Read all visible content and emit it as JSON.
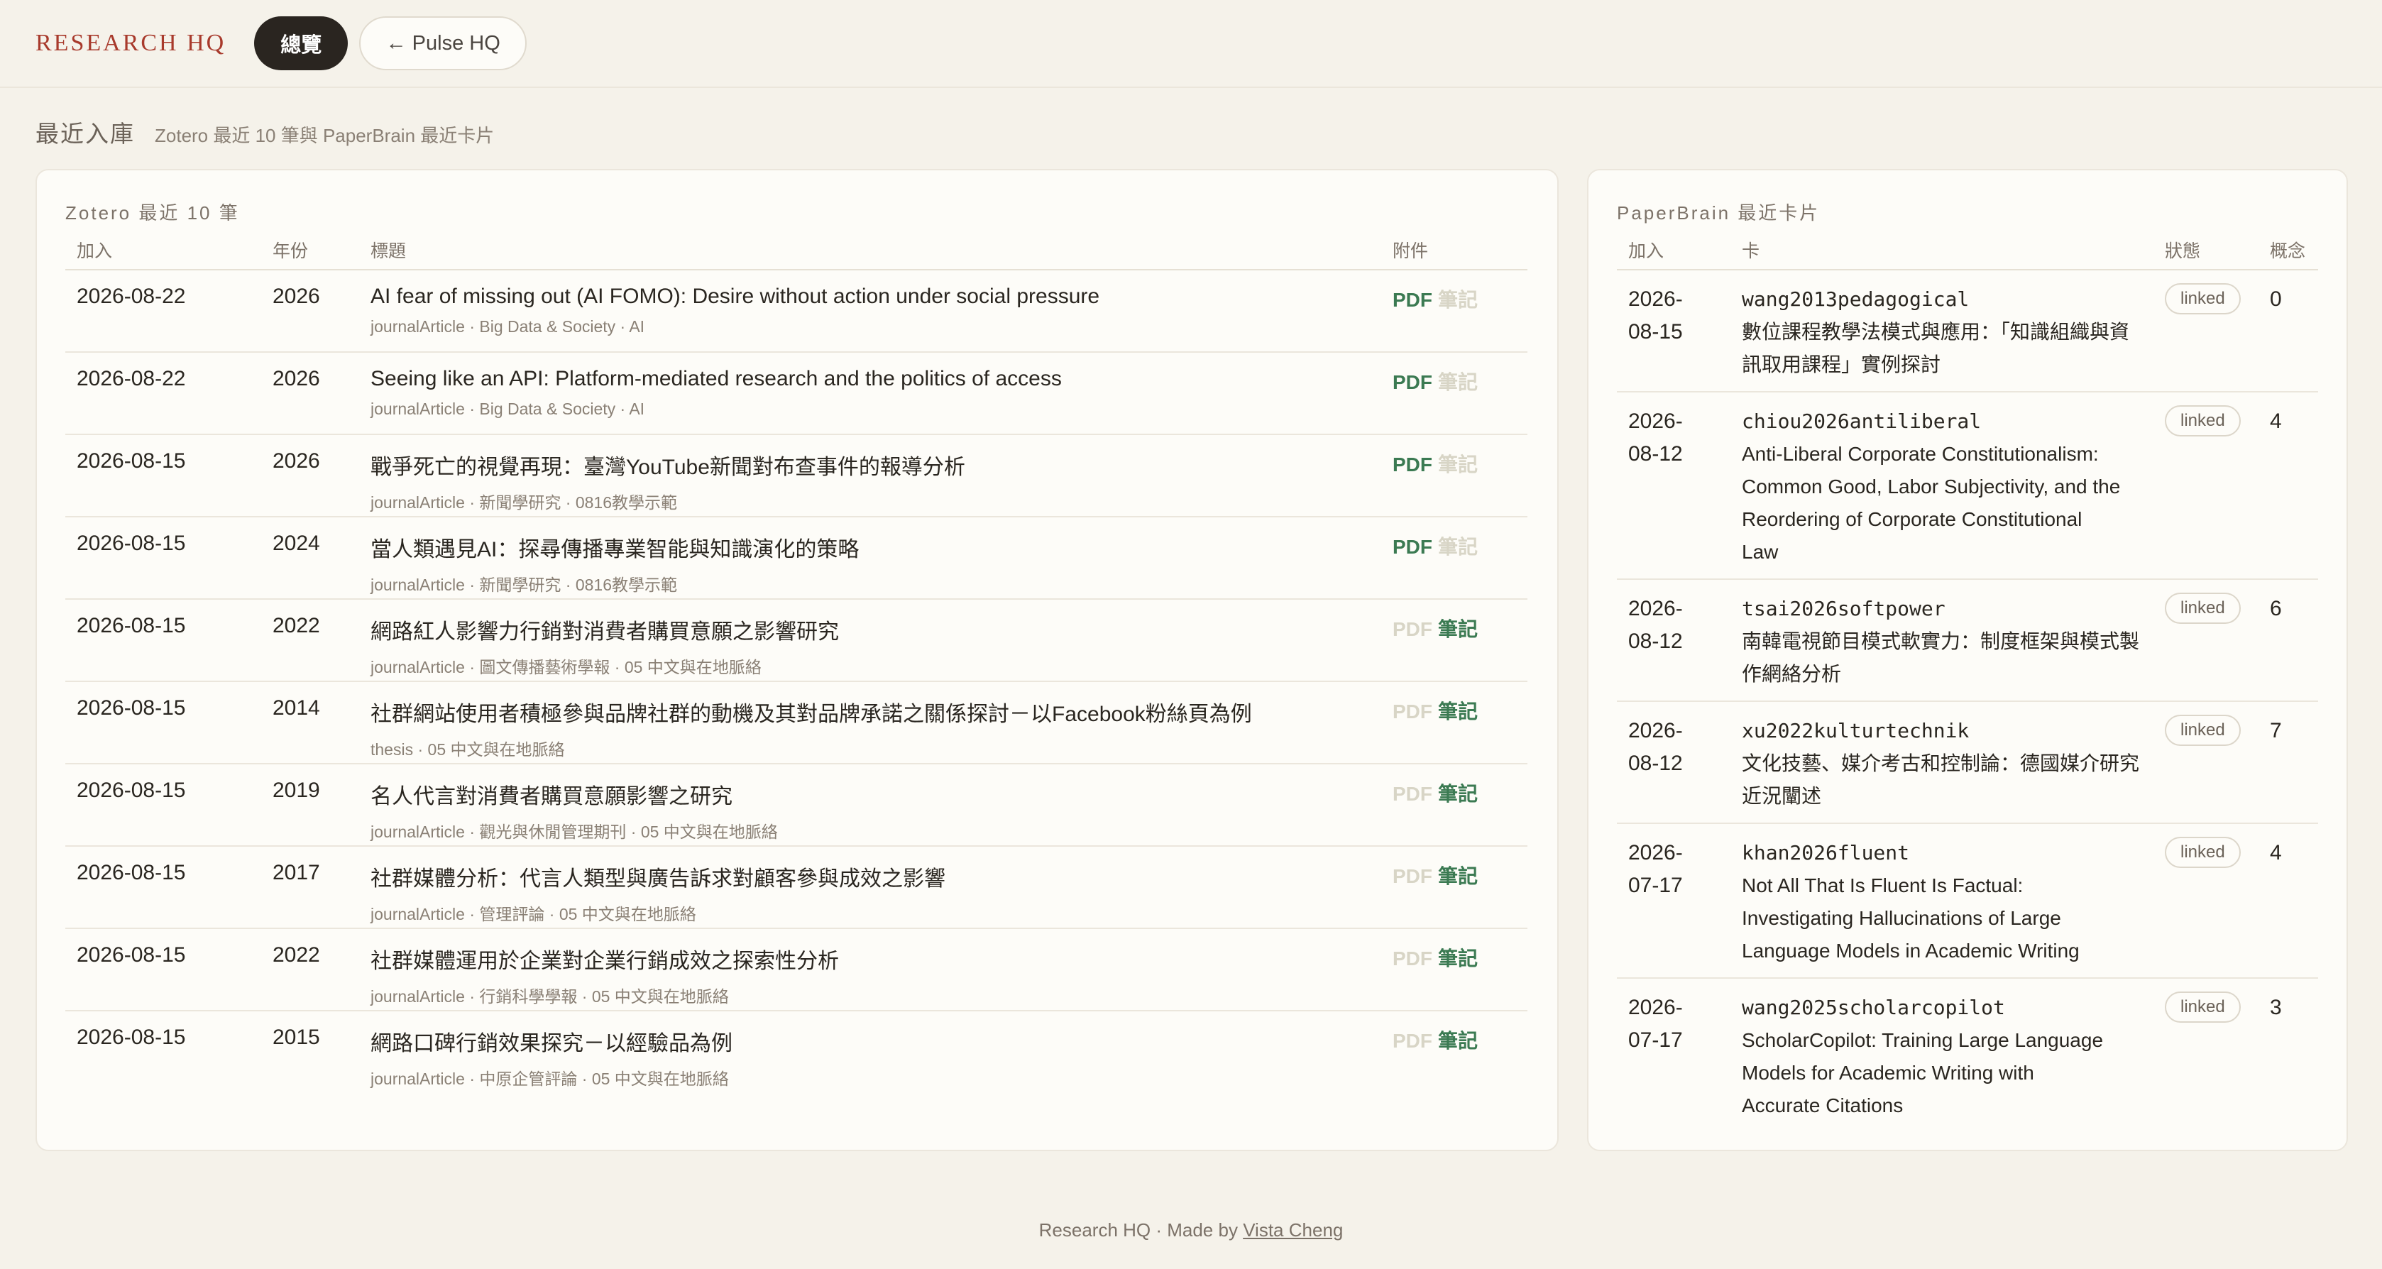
{
  "header": {
    "brand": "RESEARCH HQ",
    "tabs": [
      "總覽",
      "← Pulse HQ"
    ]
  },
  "section": {
    "title": "最近入庫",
    "subtitle": "Zotero 最近 10 筆與 PaperBrain 最近卡片"
  },
  "zotero": {
    "title": "Zotero 最近 10 筆",
    "columns": [
      "加入",
      "年份",
      "標題",
      "附件"
    ],
    "pdf_label": "PDF",
    "note_label": "筆記",
    "rows": [
      {
        "added": "2026-08-22",
        "year": "2026",
        "title": "AI fear of missing out (AI FOMO): Desire without action under social pressure",
        "meta": "journalArticle · Big Data & Society · AI",
        "pdf": true,
        "note": false
      },
      {
        "added": "2026-08-22",
        "year": "2026",
        "title": "Seeing like an API: Platform-mediated research and the politics of access",
        "meta": "journalArticle · Big Data & Society · AI",
        "pdf": true,
        "note": false
      },
      {
        "added": "2026-08-15",
        "year": "2026",
        "title": "戰爭死亡的視覺再現：臺灣YouTube新聞對布查事件的報導分析",
        "meta": "journalArticle · 新聞學研究 · 0816教學示範",
        "pdf": true,
        "note": false
      },
      {
        "added": "2026-08-15",
        "year": "2024",
        "title": "當人類遇見AI：探尋傳播專業智能與知識演化的策略",
        "meta": "journalArticle · 新聞學研究 · 0816教學示範",
        "pdf": true,
        "note": false
      },
      {
        "added": "2026-08-15",
        "year": "2022",
        "title": "網路紅人影響力行銷對消費者購買意願之影響研究",
        "meta": "journalArticle · 圖文傳播藝術學報 · 05 中文與在地脈絡",
        "pdf": false,
        "note": true
      },
      {
        "added": "2026-08-15",
        "year": "2014",
        "title": "社群網站使用者積極參與品牌社群的動機及其對品牌承諾之關係探討－以Facebook粉絲頁為例",
        "meta": "thesis · 05 中文與在地脈絡",
        "pdf": false,
        "note": true
      },
      {
        "added": "2026-08-15",
        "year": "2019",
        "title": "名人代言對消費者購買意願影響之研究",
        "meta": "journalArticle · 觀光與休閒管理期刊 · 05 中文與在地脈絡",
        "pdf": false,
        "note": true
      },
      {
        "added": "2026-08-15",
        "year": "2017",
        "title": "社群媒體分析：代言人類型與廣告訴求對顧客參與成效之影響",
        "meta": "journalArticle · 管理評論 · 05 中文與在地脈絡",
        "pdf": false,
        "note": true
      },
      {
        "added": "2026-08-15",
        "year": "2022",
        "title": "社群媒體運用於企業對企業行銷成效之探索性分析",
        "meta": "journalArticle · 行銷科學學報 · 05 中文與在地脈絡",
        "pdf": false,
        "note": true
      },
      {
        "added": "2026-08-15",
        "year": "2015",
        "title": "網路口碑行銷效果探究－以經驗品為例",
        "meta": "journalArticle · 中原企管評論 · 05 中文與在地脈絡",
        "pdf": false,
        "note": true
      }
    ]
  },
  "paperbrain": {
    "title": "PaperBrain 最近卡片",
    "columns": [
      "加入",
      "卡",
      "狀態",
      "概念"
    ],
    "rows": [
      {
        "added_1": "2026-",
        "added_2": "08-15",
        "key": "wang2013pedagogical",
        "title_lines": [
          "數位課程教學法模式與應用：「知識組織與資",
          "訊取用課程」實例探討"
        ],
        "status": "linked",
        "concepts": "0"
      },
      {
        "added_1": "2026-",
        "added_2": "08-12",
        "key": "chiou2026antiliberal",
        "title_lines": [
          "Anti-Liberal Corporate Constitutionalism:",
          "Common Good, Labor Subjectivity, and the",
          "Reordering of Corporate Constitutional",
          "Law"
        ],
        "status": "linked",
        "concepts": "4"
      },
      {
        "added_1": "2026-",
        "added_2": "08-12",
        "key": "tsai2026softpower",
        "title_lines": [
          "南韓電視節目模式軟實力：制度框架與模式製",
          "作網絡分析"
        ],
        "status": "linked",
        "concepts": "6"
      },
      {
        "added_1": "2026-",
        "added_2": "08-12",
        "key": "xu2022kulturtechnik",
        "title_lines": [
          "文化技藝、媒介考古和控制論：德國媒介研究",
          "近況闡述"
        ],
        "status": "linked",
        "concepts": "7"
      },
      {
        "added_1": "2026-",
        "added_2": "07-17",
        "key": "khan2026fluent",
        "title_lines": [
          "Not All That Is Fluent Is Factual:",
          "Investigating Hallucinations of Large",
          "Language Models in Academic Writing"
        ],
        "status": "linked",
        "concepts": "4"
      },
      {
        "added_1": "2026-",
        "added_2": "07-17",
        "key": "wang2025scholarcopilot",
        "title_lines": [
          "ScholarCopilot: Training Large Language",
          "Models for Academic Writing with",
          "Accurate Citations"
        ],
        "status": "linked",
        "concepts": "3"
      }
    ]
  },
  "footer": {
    "text": "Research HQ · Made by ",
    "link": "Vista Cheng"
  }
}
